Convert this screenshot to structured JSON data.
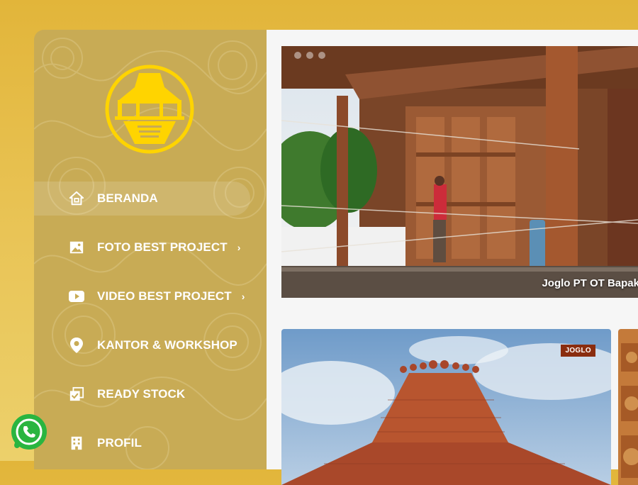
{
  "colors": {
    "page_bg": "#e2b53a",
    "sidebar_bg": "#c8ab55",
    "logo_yellow": "#ffd400",
    "badge_bg": "#8a2d0f",
    "whatsapp_green": "#2ab540"
  },
  "sidebar": {
    "logo_icon": "joglo-house-logo-icon",
    "items": [
      {
        "label": "BERANDA",
        "icon": "home-icon",
        "active": true,
        "has_submenu": false
      },
      {
        "label": "FOTO BEST PROJECT",
        "icon": "image-icon",
        "active": false,
        "has_submenu": true
      },
      {
        "label": "VIDEO BEST PROJECT",
        "icon": "youtube-icon",
        "active": false,
        "has_submenu": true
      },
      {
        "label": "KANTOR & WORKSHOP",
        "icon": "map-pin-icon",
        "active": false,
        "has_submenu": false
      },
      {
        "label": "READY STOCK",
        "icon": "stock-check-icon",
        "active": false,
        "has_submenu": false
      },
      {
        "label": "PROFIL",
        "icon": "building-icon",
        "active": false,
        "has_submenu": false
      }
    ],
    "chevron": "›"
  },
  "slider": {
    "caption": "Joglo PT OT Bapak",
    "dots": 3,
    "active_dot": 0
  },
  "cards": [
    {
      "badge": "JOGLO"
    }
  ],
  "whatsapp": {
    "icon": "whatsapp-icon"
  }
}
